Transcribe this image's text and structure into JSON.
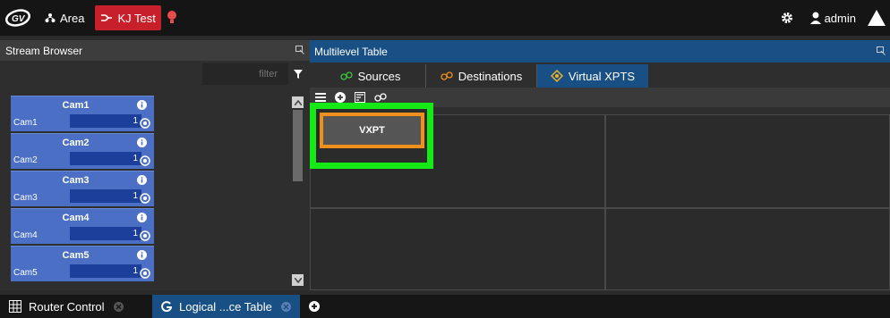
{
  "topbar": {
    "logo_icon": "gv-logo",
    "area_label": "Area",
    "area_icon": "area-tree-icon",
    "active_label": "KJ Test",
    "active_icon": "router-icon",
    "admin_label": "admin",
    "accent_color": "#c8202b"
  },
  "left": {
    "title": "Stream Browser",
    "filter_placeholder": "filter",
    "items": [
      {
        "title": "Cam1",
        "sub": "Cam1",
        "value": "1"
      },
      {
        "title": "Cam2",
        "sub": "Cam2",
        "value": "1"
      },
      {
        "title": "Cam3",
        "sub": "Cam3",
        "value": "1"
      },
      {
        "title": "Cam4",
        "sub": "Cam4",
        "value": "1"
      },
      {
        "title": "Cam5",
        "sub": "Cam5",
        "value": "1"
      }
    ]
  },
  "right": {
    "title": "Multilevel Table",
    "tabs": [
      {
        "label": "Sources"
      },
      {
        "label": "Destinations"
      },
      {
        "label": "Virtual XPTS"
      }
    ],
    "vxpt_label": "VXPT",
    "highlight_color": "#16ea16",
    "selected_color": "#f0901c"
  },
  "bottom": {
    "tabs": [
      {
        "label": "Router Control"
      },
      {
        "label": "Logical ...ce Table"
      }
    ]
  }
}
